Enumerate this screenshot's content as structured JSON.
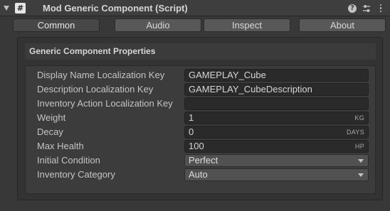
{
  "header": {
    "title": "Mod Generic Component (Script)",
    "script_glyph": "#",
    "help_glyph": "?",
    "icons": [
      "foldout-arrow-icon",
      "script-icon",
      "help-icon",
      "preset-settings-icon",
      "kebab-menu-icon"
    ]
  },
  "tabs": [
    {
      "label": "Common",
      "active": true
    },
    {
      "label": "Audio",
      "active": false
    },
    {
      "label": "Inspect",
      "active": false
    },
    {
      "label": "About",
      "active": false
    }
  ],
  "section": {
    "title": "Generic Component Properties"
  },
  "fields": {
    "display_name_key": {
      "label": "Display Name Localization Key",
      "value": "GAMEPLAY_Cube"
    },
    "description_key": {
      "label": "Description Localization Key",
      "value": "GAMEPLAY_CubeDescription"
    },
    "inventory_action_key": {
      "label": "Inventory Action Localization Key",
      "value": ""
    },
    "weight": {
      "label": "Weight",
      "value": "1",
      "unit": "KG"
    },
    "decay": {
      "label": "Decay",
      "value": "0",
      "unit": "DAYS"
    },
    "max_health": {
      "label": "Max Health",
      "value": "100",
      "unit": "HP"
    },
    "initial_condition": {
      "label": "Initial Condition",
      "value": "Perfect"
    },
    "inventory_category": {
      "label": "Inventory Category",
      "value": "Auto"
    }
  },
  "colors": {
    "background": "#383838",
    "field_bg": "#2a2a2a",
    "dropdown_bg": "#515151",
    "text": "#c4c4c4"
  }
}
